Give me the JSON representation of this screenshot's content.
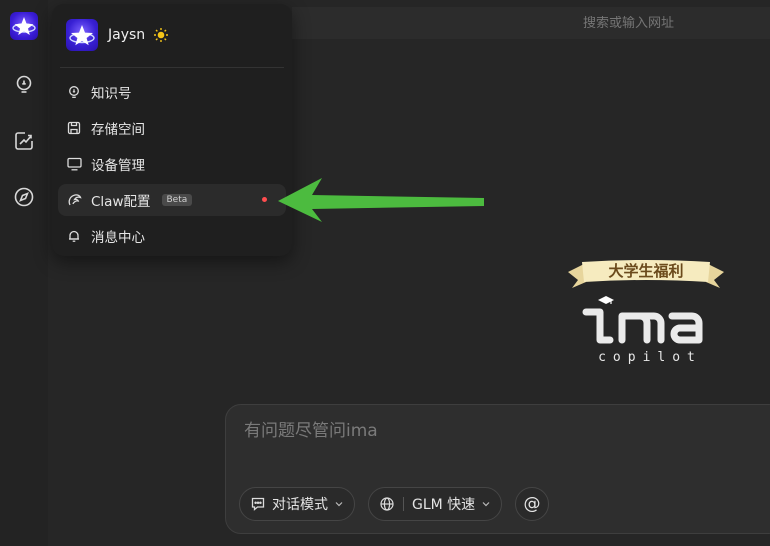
{
  "url_bar": {
    "placeholder": "搜索或输入网址"
  },
  "user": {
    "name": "Jaysn"
  },
  "menu": {
    "items": [
      {
        "label": "知识号",
        "icon": "lightbulb-icon"
      },
      {
        "label": "存储空间",
        "icon": "save-icon"
      },
      {
        "label": "设备管理",
        "icon": "monitor-icon"
      },
      {
        "label": "Claw配置",
        "icon": "claw-icon",
        "badge": "Beta",
        "notification_dot": true,
        "active": true
      },
      {
        "label": "消息中心",
        "icon": "bell-icon"
      }
    ]
  },
  "promo": {
    "banner": "大学生福利",
    "logo": "ima",
    "subtitle": "copilot"
  },
  "chat": {
    "placeholder": "有问题尽管问ima",
    "mode_label": "对话模式",
    "model_label": "GLM 快速",
    "at_label": "@"
  },
  "colors": {
    "background": "#262626",
    "menu_bg": "#1f1f1f",
    "accent_purple": "#3a1dd6",
    "arrow_green": "#4cbb3f",
    "notification_red": "#ff4d4f",
    "banner_gold": "#f3e3b0"
  }
}
